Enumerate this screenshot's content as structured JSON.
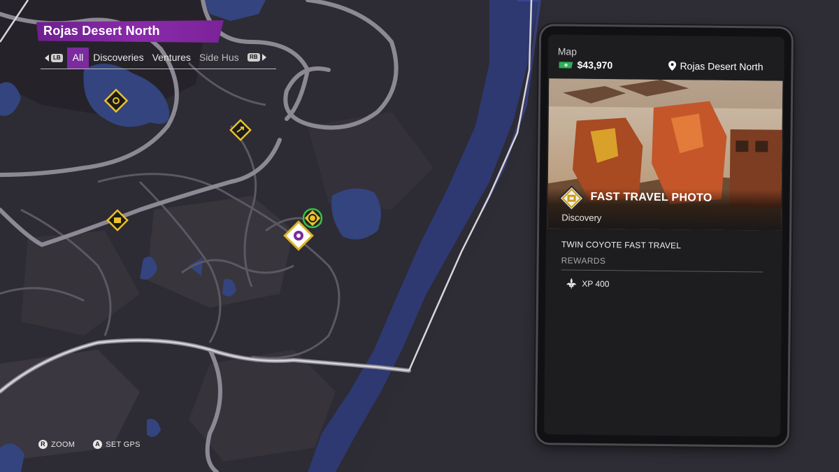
{
  "map": {
    "region_title": "Rojas Desert North",
    "filters": {
      "left_bumper": "LB",
      "right_bumper": "RB",
      "tabs": [
        "All",
        "Discoveries",
        "Ventures",
        "Side Hus"
      ],
      "active_index": 0
    },
    "markers": [
      {
        "name": "discovery-marker-1",
        "icon": "collectible-icon"
      },
      {
        "name": "discovery-marker-2",
        "icon": "arrow-icon"
      },
      {
        "name": "discovery-marker-3",
        "icon": "fast-travel-icon"
      },
      {
        "name": "selected-marker",
        "icon": "fast-travel-icon"
      },
      {
        "name": "target-marker",
        "icon": "target-icon"
      }
    ]
  },
  "controls": {
    "zoom": {
      "button": "R",
      "label": "ZOOM"
    },
    "gps": {
      "button": "A",
      "label": "SET GPS"
    }
  },
  "phone": {
    "app_name": "Map",
    "money": "$43,970",
    "location": "Rojas Desert North",
    "item": {
      "title": "FAST TRAVEL PHOTO",
      "category": "Discovery",
      "description": "TWIN COYOTE FAST TRAVEL",
      "rewards_label": "REWARDS",
      "rewards": [
        {
          "icon": "fleur-de-lis-icon",
          "text": "XP 400"
        }
      ]
    }
  },
  "colors": {
    "accent_purple": "#7b2b9e",
    "marker_gold": "#e9c12a",
    "water": "#3b4a8a",
    "land": "#2b2a31",
    "road": "#5a5560",
    "highway": "#8d8a93"
  }
}
